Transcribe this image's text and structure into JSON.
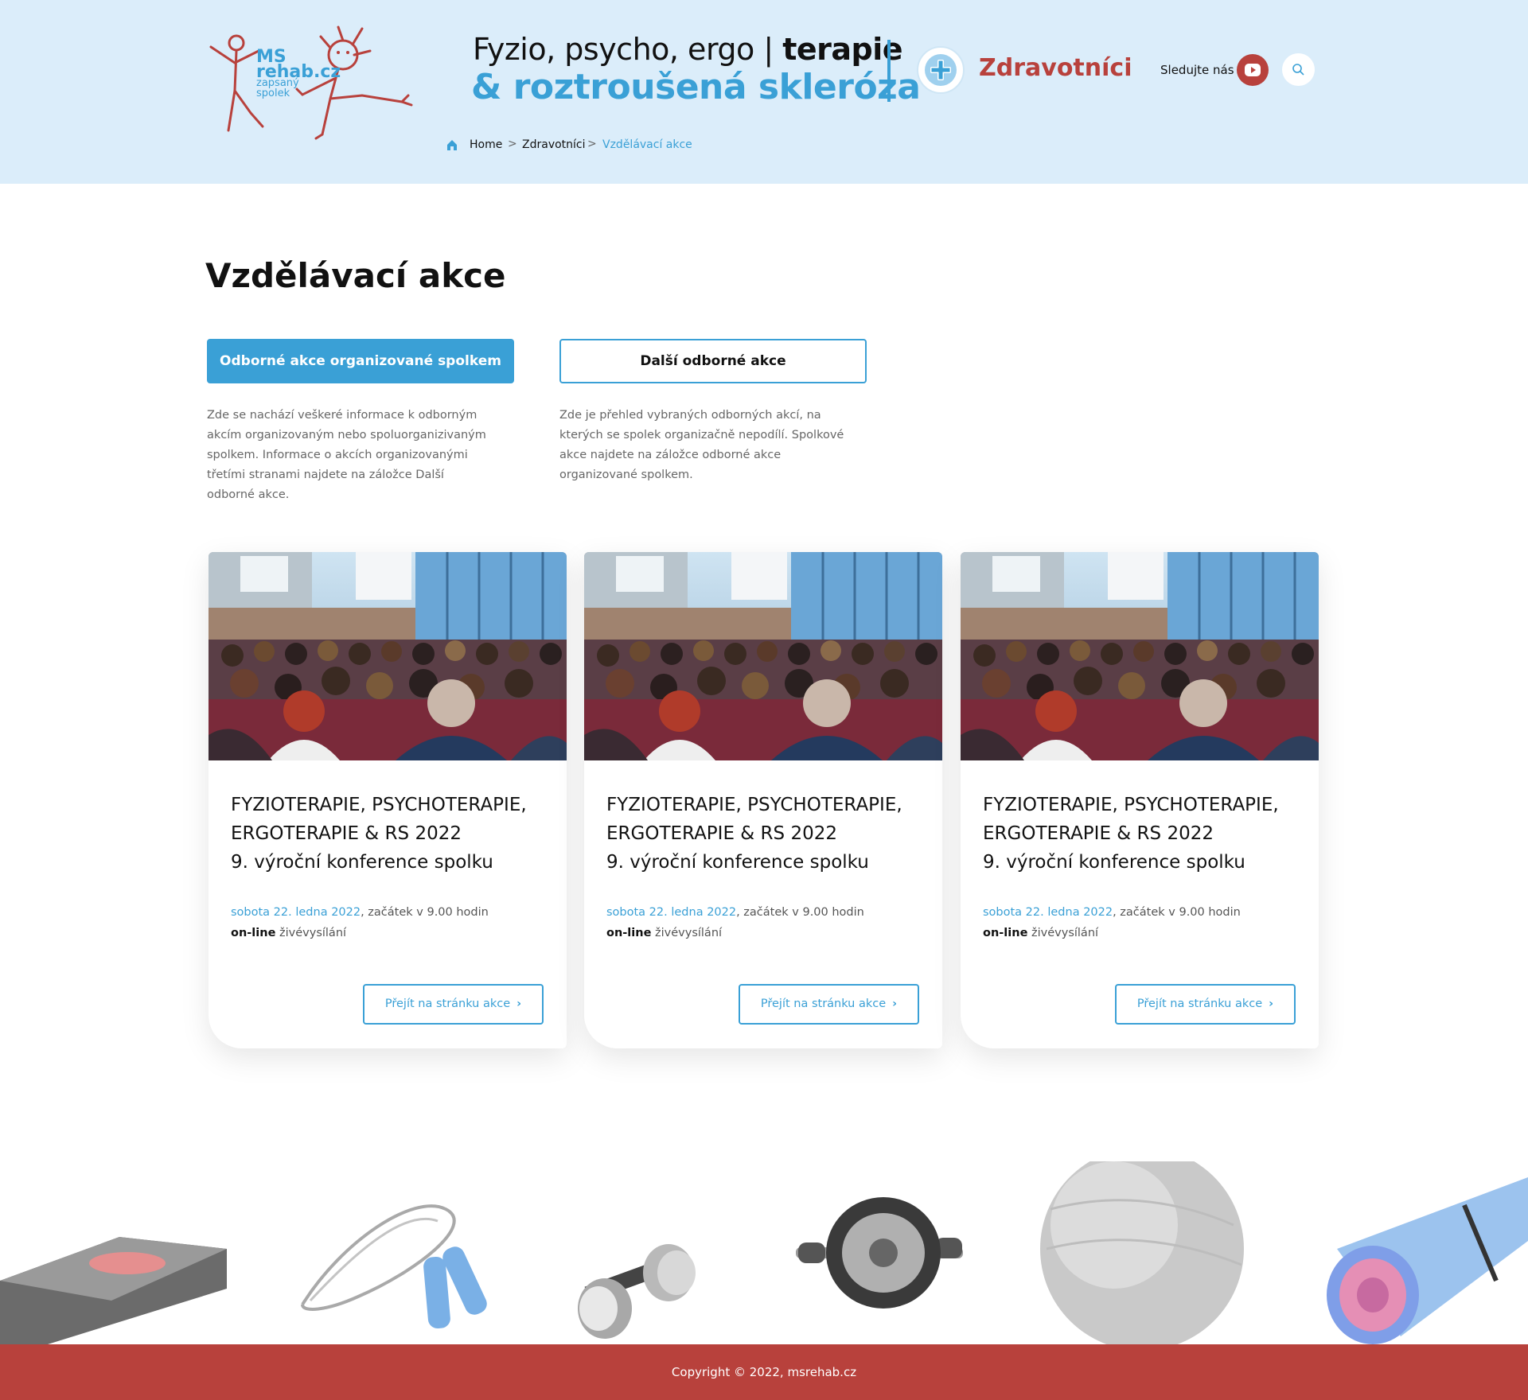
{
  "header": {
    "logo": {
      "line1": "MS",
      "line2": "rehab.cz",
      "sub1": "zapsaný",
      "sub2": "spolek"
    },
    "tagline": {
      "part1": "Fyzio, psycho, ergo | ",
      "part1_bold": "terapie",
      "part2": "& roztroušená skleróza"
    },
    "section_label": "Zdravotníci",
    "follow_label": "Sledujte nás",
    "icons": {
      "section": "plus-circle-icon",
      "social": "youtube-icon",
      "search": "search-icon",
      "home": "home-icon"
    },
    "breadcrumb": [
      "Home",
      "Zdravotníci",
      "Vzdělávací akce"
    ],
    "breadcrumb_separator": ">"
  },
  "main": {
    "title": "Vzdělávací akce",
    "tabs": [
      {
        "label": "Odborné akce organizované spolkem",
        "active": true,
        "description": "Zde se nachází veškeré informace k odborným akcím organizovaným nebo spoluorganizivaným spolkem. Informace o akcích organizovanými třetími stranami najdete na záložce Další odborné akce."
      },
      {
        "label": "Další odborné akce",
        "active": false,
        "description": "Zde je přehled vybraných odborných akcí, na kterých se spolek organizačně nepodílí. Spolkové akce najdete na záložce odborné akce organizované spolkem."
      }
    ],
    "cards": [
      {
        "title_line1": "FYZIOTERAPIE, PSYCHOTERAPIE,",
        "title_line2": "ERGOTERAPIE & RS 2022",
        "title_line3": "9. výroční konference spolku",
        "date": "sobota 22. ledna 2022",
        "time": ", začátek v 9.00 hodin",
        "mode_bold": "on-line",
        "mode": " živévysílání",
        "button": "Přejít na stránku akce"
      },
      {
        "title_line1": "FYZIOTERAPIE, PSYCHOTERAPIE,",
        "title_line2": "ERGOTERAPIE & RS 2022",
        "title_line3": "9. výroční konference spolku",
        "date": "sobota 22. ledna 2022",
        "time": ", začátek v 9.00 hodin",
        "mode_bold": "on-line",
        "mode": " živévysílání",
        "button": "Přejít na stránku akce"
      },
      {
        "title_line1": "FYZIOTERAPIE, PSYCHOTERAPIE,",
        "title_line2": "ERGOTERAPIE & RS 2022",
        "title_line3": "9. výroční konference spolku",
        "date": "sobota 22. ledna 2022",
        "time": ", začátek v 9.00 hodin",
        "mode_bold": "on-line",
        "mode": " živévysílání",
        "button": "Přejít na stránku akce"
      }
    ]
  },
  "footer": {
    "copyright": "Copyright © 2022, msrehab.cz"
  },
  "colors": {
    "accent_blue": "#3aa0d6",
    "brand_red": "#b8413c",
    "header_bg": "#dbedfa"
  }
}
